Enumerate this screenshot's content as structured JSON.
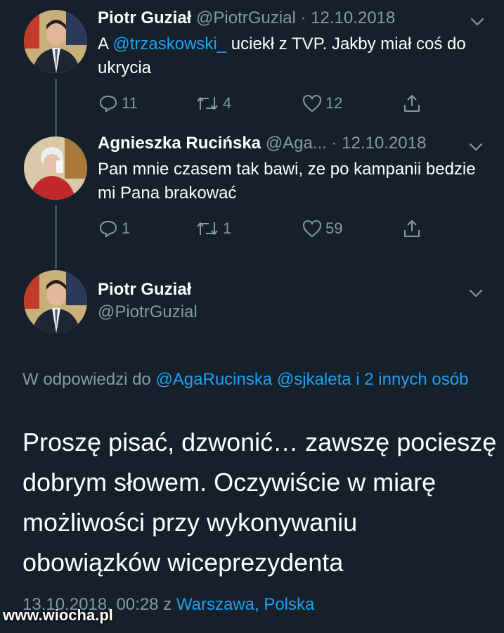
{
  "tweet1": {
    "name": "Piotr Guział",
    "handle": "@PiotrGuzial",
    "date": "· 12.10.2018",
    "text_prefix": "A ",
    "mention": "@trzaskowski_",
    "text_suffix": " uciekł z TVP. Jakby miał coś do ukrycia",
    "replies": "11",
    "retweets": "4",
    "likes": "12"
  },
  "tweet2": {
    "name": "Agnieszka Rucińska",
    "handle": "@Aga...",
    "date": "· 12.10.2018",
    "text": "Pan mnie czasem tak bawi, ze po kampanii bedzie mi Pana brakować",
    "replies": "1",
    "retweets": "1",
    "likes": "59"
  },
  "tweet3": {
    "name": "Piotr Guział",
    "handle": "@PiotrGuzial",
    "reply_prefix": "W odpowiedzi do ",
    "reply_targets": "@AgaRucinska @sjkaleta i 2 innych osób",
    "text": "Proszę pisać, dzwonić… zawszę pocieszę dobrym słowem. Oczywiście w miarę możliwości przy wykonywaniu obowiązków wiceprezydenta",
    "timestamp": "13.10.2018, 00:28 z ",
    "location": "Warszawa, Polska"
  },
  "watermark": "www.wiocha.pl",
  "colors": {
    "background": "#15202b",
    "accent": "#1da1f2",
    "muted": "#8899a6",
    "thread_line": "#3d5466"
  },
  "icons": [
    "reply-icon",
    "retweet-icon",
    "like-icon",
    "share-icon",
    "chevron-down-icon"
  ]
}
